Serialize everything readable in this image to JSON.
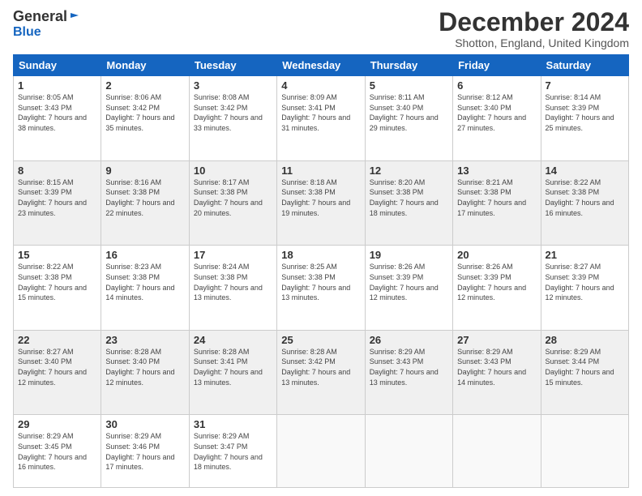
{
  "header": {
    "logo": {
      "general": "General",
      "blue": "Blue"
    },
    "title": "December 2024",
    "subtitle": "Shotton, England, United Kingdom"
  },
  "days": [
    "Sunday",
    "Monday",
    "Tuesday",
    "Wednesday",
    "Thursday",
    "Friday",
    "Saturday"
  ],
  "weeks": [
    [
      {
        "day": "1",
        "sunrise": "8:05 AM",
        "sunset": "3:43 PM",
        "daylight": "7 hours and 38 minutes."
      },
      {
        "day": "2",
        "sunrise": "8:06 AM",
        "sunset": "3:42 PM",
        "daylight": "7 hours and 35 minutes."
      },
      {
        "day": "3",
        "sunrise": "8:08 AM",
        "sunset": "3:42 PM",
        "daylight": "7 hours and 33 minutes."
      },
      {
        "day": "4",
        "sunrise": "8:09 AM",
        "sunset": "3:41 PM",
        "daylight": "7 hours and 31 minutes."
      },
      {
        "day": "5",
        "sunrise": "8:11 AM",
        "sunset": "3:40 PM",
        "daylight": "7 hours and 29 minutes."
      },
      {
        "day": "6",
        "sunrise": "8:12 AM",
        "sunset": "3:40 PM",
        "daylight": "7 hours and 27 minutes."
      },
      {
        "day": "7",
        "sunrise": "8:14 AM",
        "sunset": "3:39 PM",
        "daylight": "7 hours and 25 minutes."
      }
    ],
    [
      {
        "day": "8",
        "sunrise": "8:15 AM",
        "sunset": "3:39 PM",
        "daylight": "7 hours and 23 minutes."
      },
      {
        "day": "9",
        "sunrise": "8:16 AM",
        "sunset": "3:38 PM",
        "daylight": "7 hours and 22 minutes."
      },
      {
        "day": "10",
        "sunrise": "8:17 AM",
        "sunset": "3:38 PM",
        "daylight": "7 hours and 20 minutes."
      },
      {
        "day": "11",
        "sunrise": "8:18 AM",
        "sunset": "3:38 PM",
        "daylight": "7 hours and 19 minutes."
      },
      {
        "day": "12",
        "sunrise": "8:20 AM",
        "sunset": "3:38 PM",
        "daylight": "7 hours and 18 minutes."
      },
      {
        "day": "13",
        "sunrise": "8:21 AM",
        "sunset": "3:38 PM",
        "daylight": "7 hours and 17 minutes."
      },
      {
        "day": "14",
        "sunrise": "8:22 AM",
        "sunset": "3:38 PM",
        "daylight": "7 hours and 16 minutes."
      }
    ],
    [
      {
        "day": "15",
        "sunrise": "8:22 AM",
        "sunset": "3:38 PM",
        "daylight": "7 hours and 15 minutes."
      },
      {
        "day": "16",
        "sunrise": "8:23 AM",
        "sunset": "3:38 PM",
        "daylight": "7 hours and 14 minutes."
      },
      {
        "day": "17",
        "sunrise": "8:24 AM",
        "sunset": "3:38 PM",
        "daylight": "7 hours and 13 minutes."
      },
      {
        "day": "18",
        "sunrise": "8:25 AM",
        "sunset": "3:38 PM",
        "daylight": "7 hours and 13 minutes."
      },
      {
        "day": "19",
        "sunrise": "8:26 AM",
        "sunset": "3:39 PM",
        "daylight": "7 hours and 12 minutes."
      },
      {
        "day": "20",
        "sunrise": "8:26 AM",
        "sunset": "3:39 PM",
        "daylight": "7 hours and 12 minutes."
      },
      {
        "day": "21",
        "sunrise": "8:27 AM",
        "sunset": "3:39 PM",
        "daylight": "7 hours and 12 minutes."
      }
    ],
    [
      {
        "day": "22",
        "sunrise": "8:27 AM",
        "sunset": "3:40 PM",
        "daylight": "7 hours and 12 minutes."
      },
      {
        "day": "23",
        "sunrise": "8:28 AM",
        "sunset": "3:40 PM",
        "daylight": "7 hours and 12 minutes."
      },
      {
        "day": "24",
        "sunrise": "8:28 AM",
        "sunset": "3:41 PM",
        "daylight": "7 hours and 13 minutes."
      },
      {
        "day": "25",
        "sunrise": "8:28 AM",
        "sunset": "3:42 PM",
        "daylight": "7 hours and 13 minutes."
      },
      {
        "day": "26",
        "sunrise": "8:29 AM",
        "sunset": "3:43 PM",
        "daylight": "7 hours and 13 minutes."
      },
      {
        "day": "27",
        "sunrise": "8:29 AM",
        "sunset": "3:43 PM",
        "daylight": "7 hours and 14 minutes."
      },
      {
        "day": "28",
        "sunrise": "8:29 AM",
        "sunset": "3:44 PM",
        "daylight": "7 hours and 15 minutes."
      }
    ],
    [
      {
        "day": "29",
        "sunrise": "8:29 AM",
        "sunset": "3:45 PM",
        "daylight": "7 hours and 16 minutes."
      },
      {
        "day": "30",
        "sunrise": "8:29 AM",
        "sunset": "3:46 PM",
        "daylight": "7 hours and 17 minutes."
      },
      {
        "day": "31",
        "sunrise": "8:29 AM",
        "sunset": "3:47 PM",
        "daylight": "7 hours and 18 minutes."
      },
      null,
      null,
      null,
      null
    ]
  ]
}
